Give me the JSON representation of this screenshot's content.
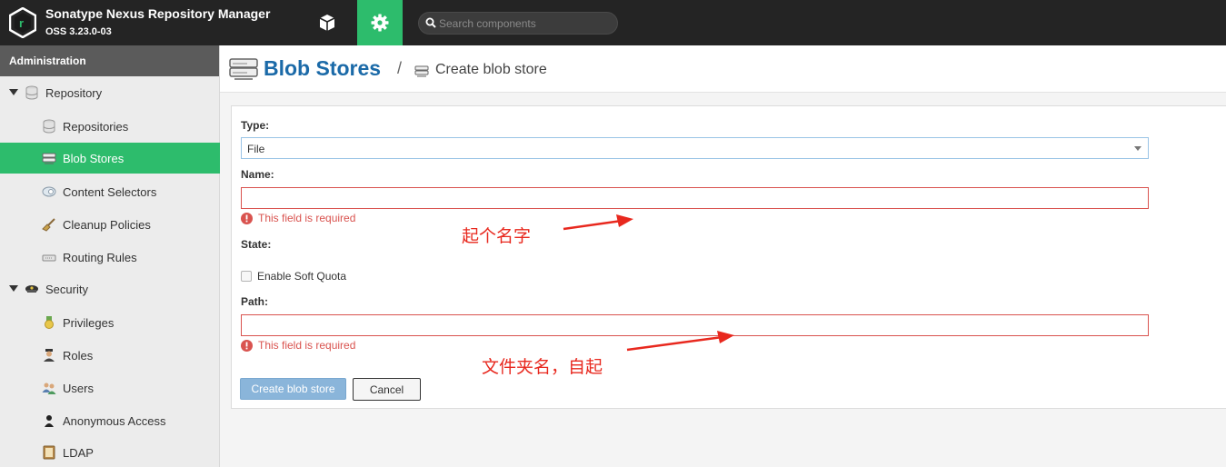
{
  "app": {
    "title": "Sonatype Nexus Repository Manager",
    "version": "OSS 3.23.0-03",
    "accent_color": "#2dbc6c"
  },
  "topbar": {
    "browse_icon": "cube-icon",
    "admin_icon": "gear-icon",
    "search_placeholder": "Search components"
  },
  "sidebar": {
    "header": "Administration",
    "items": [
      {
        "label": "Repository",
        "icon": "database-icon",
        "type": "group"
      },
      {
        "label": "Repositories",
        "icon": "database-icon",
        "type": "child"
      },
      {
        "label": "Blob Stores",
        "icon": "server-icon",
        "type": "child",
        "active": true
      },
      {
        "label": "Content Selectors",
        "icon": "selector-icon",
        "type": "child"
      },
      {
        "label": "Cleanup Policies",
        "icon": "broom-icon",
        "type": "child"
      },
      {
        "label": "Routing Rules",
        "icon": "router-icon",
        "type": "child"
      },
      {
        "label": "Security",
        "icon": "police-cap-icon",
        "type": "group"
      },
      {
        "label": "Privileges",
        "icon": "medal-icon",
        "type": "child"
      },
      {
        "label": "Roles",
        "icon": "officer-icon",
        "type": "child"
      },
      {
        "label": "Users",
        "icon": "users-icon",
        "type": "child"
      },
      {
        "label": "Anonymous Access",
        "icon": "user-icon",
        "type": "child"
      },
      {
        "label": "LDAP",
        "icon": "book-icon",
        "type": "child"
      }
    ]
  },
  "breadcrumb": {
    "title": "Blob Stores",
    "separator": "/",
    "current": "Create blob store"
  },
  "form": {
    "type_label": "Type:",
    "type_value": "File",
    "name_label": "Name:",
    "name_value": "",
    "name_error": "This field is required",
    "state_label": "State:",
    "soft_quota_label": "Enable Soft Quota",
    "soft_quota_checked": false,
    "path_label": "Path:",
    "path_value": "",
    "path_error": "This field is required",
    "create_button": "Create blob store",
    "cancel_button": "Cancel"
  },
  "annotations": {
    "name_note": "起个名字",
    "path_note": "文件夹名，自起",
    "color": "#e8281e"
  }
}
